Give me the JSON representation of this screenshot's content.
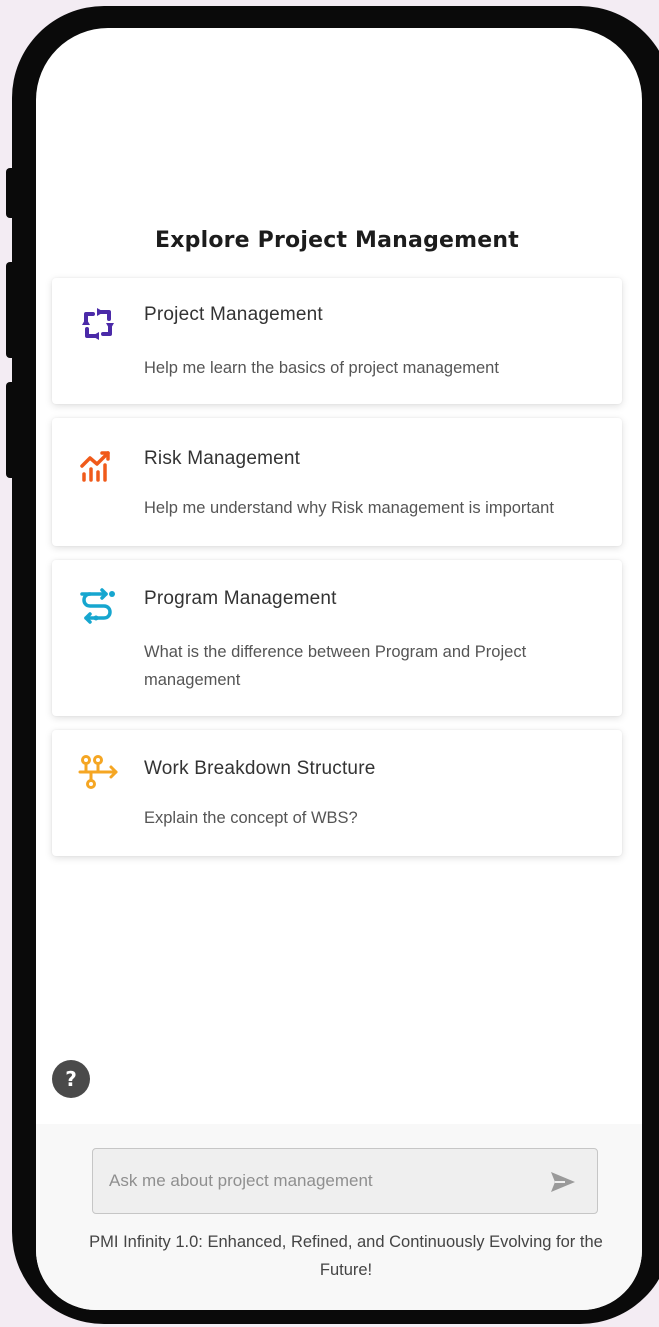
{
  "page": {
    "title": "Explore Project Management"
  },
  "cards": [
    {
      "icon": "refresh-cycle-icon",
      "icon_color": "#4b2aa8",
      "title": "Project Management",
      "description": "Help me learn the basics of project management"
    },
    {
      "icon": "chart-trend-icon",
      "icon_color": "#f05a1a",
      "title": "Risk Management",
      "description": "Help me understand why Risk management is important"
    },
    {
      "icon": "route-icon",
      "icon_color": "#16a6cf",
      "title": "Program Management",
      "description": "What is the difference between Program and Project management"
    },
    {
      "icon": "hierarchy-flow-icon",
      "icon_color": "#f5a623",
      "title": "Work Breakdown Structure",
      "description": "Explain the concept of WBS?"
    }
  ],
  "help": {
    "label": "?"
  },
  "chat": {
    "placeholder": "Ask me about project management",
    "value": ""
  },
  "footer": {
    "note": "PMI Infinity 1.0: Enhanced, Refined, and Continuously Evolving for the Future!"
  },
  "colors": {
    "send_icon": "#9a9a9a",
    "help_bg": "#4a4a4a"
  }
}
